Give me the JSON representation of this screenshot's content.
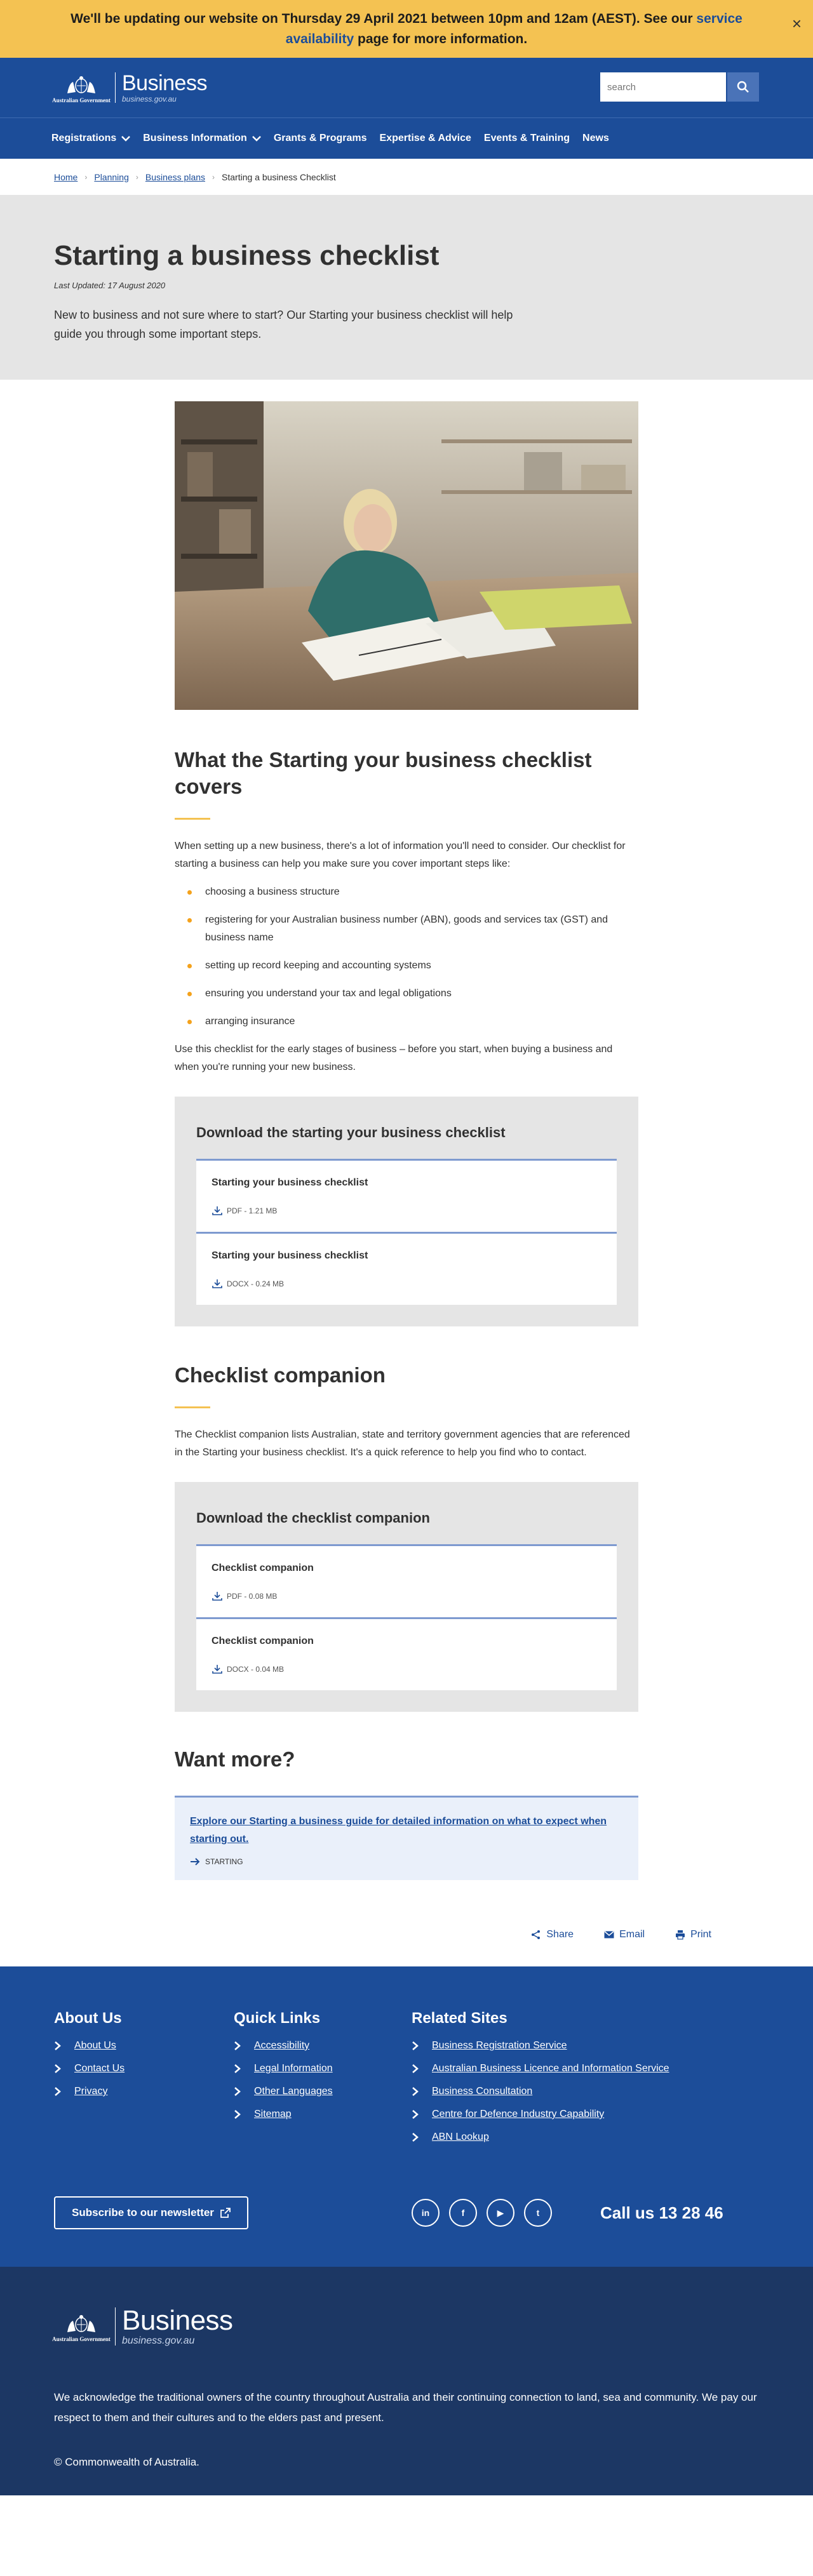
{
  "alert": {
    "text_before": "We'll be updating our website on Thursday 29 April 2021 between 10pm and 12am (AEST). See our",
    "link": "service availability",
    "text_after": "page for more information.",
    "close": "×"
  },
  "header": {
    "gov_name": "Australian Government",
    "brand": "Business",
    "brand_domain": "business.gov.au",
    "search_placeholder": "search"
  },
  "nav": {
    "items": [
      "Registrations",
      "Business Information",
      "Grants & Programs",
      "Expertise & Advice",
      "Events & Training",
      "News"
    ]
  },
  "breadcrumb": {
    "items": [
      "Home",
      "Planning",
      "Business plans"
    ],
    "current": "Starting a business Checklist"
  },
  "hero": {
    "title": "Starting a business checklist",
    "updated": "Last Updated: 17 August 2020",
    "intro": "New to business and not sure where to start? Our Starting your business checklist will help guide you through some important steps."
  },
  "section1": {
    "heading": "What the Starting your business checklist covers",
    "intro": "When setting up a new business, there's a lot of information you'll need to consider. Our checklist for starting a business can help you make sure you cover important steps like:",
    "bullets": [
      "choosing a business structure",
      "registering for your Australian business number (ABN), goods and services tax (GST) and business name",
      "setting up record keeping and accounting systems",
      "ensuring you understand your tax and legal obligations",
      "arranging insurance"
    ],
    "outro": "Use this checklist for the early stages of business – before you start, when buying a business and when you're running your new business."
  },
  "download1": {
    "title": "Download the starting your business checklist",
    "items": [
      {
        "name": "Starting your business checklist",
        "meta": "PDF - 1.21 MB"
      },
      {
        "name": "Starting your business checklist",
        "meta": "DOCX - 0.24 MB"
      }
    ]
  },
  "section2": {
    "heading": "Checklist companion",
    "text": "The Checklist companion lists Australian, state and territory government agencies that are referenced in the Starting your business checklist. It's a quick reference to help you find who to contact."
  },
  "download2": {
    "title": "Download the checklist companion",
    "items": [
      {
        "name": "Checklist companion",
        "meta": "PDF - 0.08 MB"
      },
      {
        "name": "Checklist companion",
        "meta": "DOCX - 0.04 MB"
      }
    ]
  },
  "want": {
    "heading": "Want more?",
    "link": "Explore our Starting a business guide for detailed information on what to expect when starting out.",
    "tag": "STARTING"
  },
  "share": {
    "share": "Share",
    "email": "Email",
    "print": "Print"
  },
  "footer": {
    "about": {
      "title": "About Us",
      "links": [
        "About Us",
        "Contact Us",
        "Privacy"
      ]
    },
    "quick": {
      "title": "Quick Links",
      "links": [
        "Accessibility",
        "Legal Information",
        "Other Languages",
        "Sitemap"
      ]
    },
    "related": {
      "title": "Related Sites",
      "links": [
        "Business Registration Service",
        "Australian Business Licence and Information Service",
        "Business Consultation",
        "Centre for Defence Industry Capability",
        "ABN Lookup"
      ]
    },
    "subscribe": "Subscribe to our newsletter",
    "social": [
      "in",
      "f",
      "▶",
      "t"
    ],
    "call": "Call us 13 28 46"
  },
  "footer2": {
    "gov_name": "Australian Government",
    "brand": "Business",
    "brand_domain": "business.gov.au",
    "ack": "We acknowledge the traditional owners of the country throughout Australia and their continuing connection to land, sea and community. We pay our respect to them and their cultures and to the elders past and present.",
    "copyright": "© Commonwealth of Australia."
  }
}
